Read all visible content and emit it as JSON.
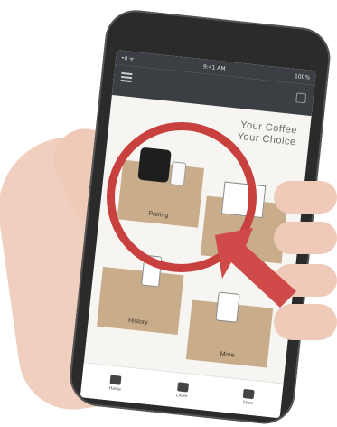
{
  "status_bar": {
    "carrier": "•ıl ᯤ",
    "time": "9:41 AM",
    "battery": "100%"
  },
  "app": {
    "title_line1": "Your Coffee",
    "title_line2": "Your Choice",
    "tiles": [
      {
        "label": "Pairing"
      },
      {
        "label": "Guide"
      },
      {
        "label": "History"
      },
      {
        "label": "More"
      }
    ],
    "bottom_nav": [
      {
        "label": "Home"
      },
      {
        "label": "Order"
      },
      {
        "label": "Store"
      }
    ]
  },
  "annotation": {
    "circle_color": "#c8413f",
    "arrow_color": "#d04a4a"
  },
  "colors": {
    "tile_bg": "#c9ad8b",
    "appbar_bg": "#3b3f44"
  }
}
